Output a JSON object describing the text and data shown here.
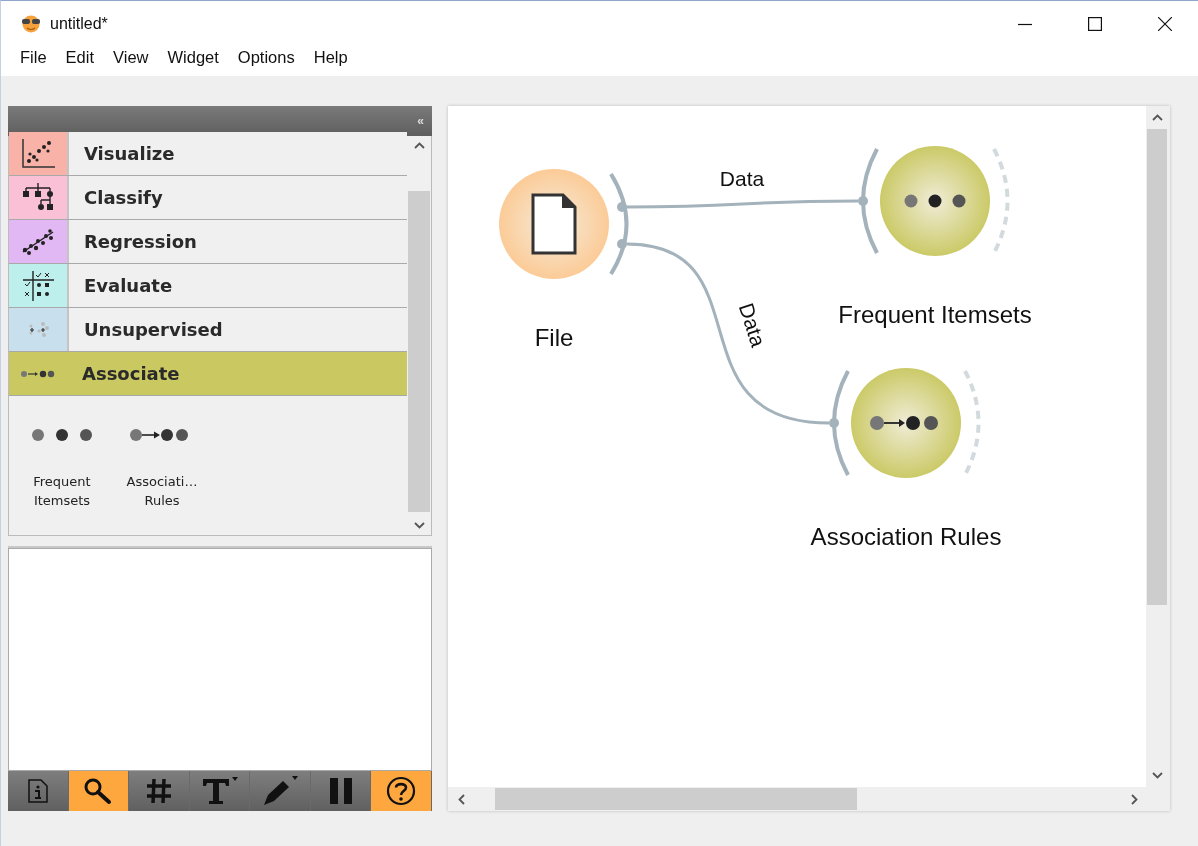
{
  "window": {
    "title": "untitled*"
  },
  "menu": [
    "File",
    "Edit",
    "View",
    "Widget",
    "Options",
    "Help"
  ],
  "panel": {
    "collapse": "«"
  },
  "categories": [
    {
      "label": "Visualize",
      "kind": "visualize",
      "color": "#f9b2a8",
      "selected": false
    },
    {
      "label": "Classify",
      "kind": "classify",
      "color": "#f9c0d6",
      "selected": false
    },
    {
      "label": "Regression",
      "kind": "regression",
      "color": "#e2b8f4",
      "selected": false
    },
    {
      "label": "Evaluate",
      "kind": "evaluate",
      "color": "#bdf0ec",
      "selected": false
    },
    {
      "label": "Unsupervised",
      "kind": "unsupervised",
      "color": "#c8e0ee",
      "selected": false
    },
    {
      "label": "Associate",
      "kind": "associate",
      "color": "#c9c861",
      "selected": true
    }
  ],
  "widgets": [
    {
      "kind": "itemsets",
      "lines": [
        "Frequent",
        "Itemsets"
      ]
    },
    {
      "kind": "rules",
      "lines": [
        "Associati…",
        "Rules"
      ]
    }
  ],
  "toolbar": [
    {
      "kind": "info",
      "on": false
    },
    {
      "kind": "search",
      "on": true
    },
    {
      "kind": "grid",
      "on": false
    },
    {
      "kind": "text",
      "on": false
    },
    {
      "kind": "pen",
      "on": false
    },
    {
      "kind": "pause",
      "on": false
    },
    {
      "kind": "help",
      "on": true
    }
  ],
  "canvas": {
    "nodes": [
      {
        "title": "File",
        "kind": "file",
        "color": "#fcc993"
      },
      {
        "title": "Frequent Itemsets",
        "kind": "itemsets",
        "color": "#c9c861"
      },
      {
        "title": "Association Rules",
        "kind": "rules",
        "color": "#c9c861"
      }
    ],
    "links": [
      {
        "label": "Data"
      },
      {
        "label": "Data"
      }
    ]
  }
}
